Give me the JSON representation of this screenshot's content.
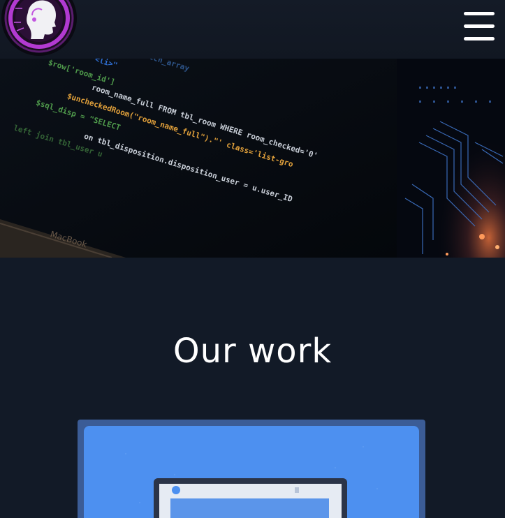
{
  "header": {
    "logo_icon": "ai-head-logo",
    "menu_icon": "hamburger-menu-icon"
  },
  "hero": {
    "code_lines": [
      "room_name_full FROM tbl_room WHERE room_checked='0'",
      "$uncheckedRoom(\"room_name_full\").\"' class='list-gro",
      "on tbl_disposition.disposition_user = u.user_ID"
    ],
    "laptop_brand": "MacBook"
  },
  "work_section": {
    "title": "Our work"
  },
  "colors": {
    "background": "#121a27",
    "card_border": "#3b5c96",
    "card_fill": "#4d90f0",
    "logo_purple": "#b23ad1"
  }
}
